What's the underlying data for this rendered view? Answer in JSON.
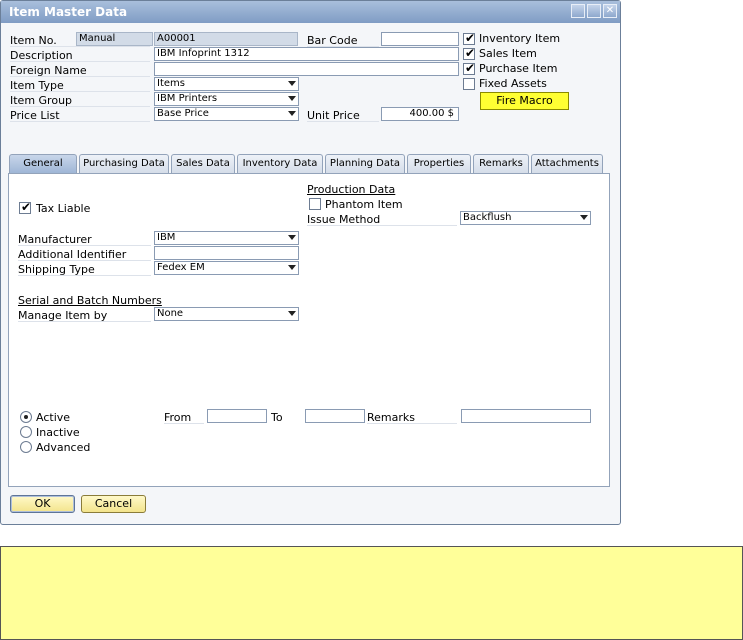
{
  "window": {
    "title": "Item Master Data"
  },
  "header": {
    "item_no_label": "Item No.",
    "series": "Manual",
    "item_no": "A00001",
    "description_label": "Description",
    "description": "IBM Infoprint 1312",
    "foreign_name_label": "Foreign Name",
    "foreign_name": "",
    "item_type_label": "Item Type",
    "item_type": "Items",
    "item_group_label": "Item Group",
    "item_group": "IBM Printers",
    "price_list_label": "Price List",
    "price_list": "Base Price",
    "bar_code_label": "Bar Code",
    "bar_code": "",
    "unit_price_label": "Unit Price",
    "unit_price": "400.00 $",
    "inventory_item": "Inventory Item",
    "sales_item": "Sales Item",
    "purchase_item": "Purchase Item",
    "fixed_assets": "Fixed Assets",
    "fire_macro": "Fire Macro"
  },
  "tabs": [
    "General",
    "Purchasing Data",
    "Sales Data",
    "Inventory Data",
    "Planning Data",
    "Properties",
    "Remarks",
    "Attachments"
  ],
  "general": {
    "tax_liable": "Tax Liable",
    "production_data": "Production Data",
    "phantom_item": "Phantom Item",
    "issue_method_label": "Issue Method",
    "issue_method": "Backflush",
    "manufacturer_label": "Manufacturer",
    "manufacturer": "IBM",
    "additional_identifier_label": "Additional Identifier",
    "additional_identifier": "",
    "shipping_type_label": "Shipping Type",
    "shipping_type": "Fedex EM",
    "serial_batch": "Serial and Batch Numbers",
    "manage_item_by_label": "Manage Item by",
    "manage_item_by": "None",
    "active": "Active",
    "inactive": "Inactive",
    "advanced": "Advanced",
    "from_label": "From",
    "to_label": "To",
    "remarks_label": "Remarks"
  },
  "buttons": {
    "ok": "OK",
    "cancel": "Cancel"
  },
  "colors": {
    "accent": "#ffff33",
    "titlebar": "#8fa9cf",
    "message_bar": "#ffff99"
  }
}
